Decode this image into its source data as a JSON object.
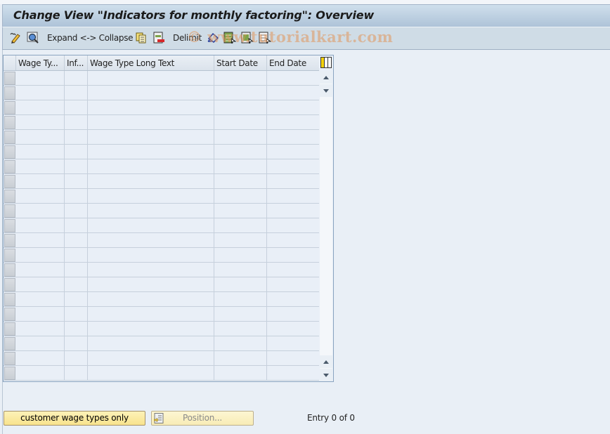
{
  "window": {
    "title": "Change View \"Indicators for monthly factoring\": Overview"
  },
  "toolbar": {
    "items": [
      {
        "type": "icon",
        "icon": "display-change-icon",
        "label": ""
      },
      {
        "type": "icon",
        "icon": "find-icon",
        "label": ""
      },
      {
        "type": "text",
        "label": "Expand <-> Collapse"
      },
      {
        "type": "icon",
        "icon": "copy-as-icon",
        "label": ""
      },
      {
        "type": "icon",
        "icon": "delete-icon",
        "label": ""
      },
      {
        "type": "text",
        "label": "Delimit"
      },
      {
        "type": "icon",
        "icon": "undo-change-icon",
        "label": ""
      },
      {
        "type": "icon",
        "icon": "select-all-icon",
        "label": ""
      },
      {
        "type": "icon",
        "icon": "select-block-icon",
        "label": ""
      },
      {
        "type": "icon",
        "icon": "deselect-all-icon",
        "label": ""
      }
    ],
    "expand_collapse_label": "Expand <-> Collapse",
    "delimit_label": "Delimit",
    "watermark": "© www.tutorialkart.com"
  },
  "table": {
    "columns": [
      {
        "key": "wage_type",
        "label": "Wage Ty..."
      },
      {
        "key": "inf",
        "label": "Inf..."
      },
      {
        "key": "long_text",
        "label": "Wage Type Long Text"
      },
      {
        "key": "start_date",
        "label": "Start Date"
      },
      {
        "key": "end_date",
        "label": "End Date"
      }
    ],
    "rows": [],
    "visible_empty_rows": 21
  },
  "footer": {
    "customer_button_label": "customer wage types only",
    "position_button_label": "Position...",
    "entry_status": "Entry 0 of 0"
  },
  "colors": {
    "title_bar": "#aec3d8",
    "toolbar": "#cfdce6",
    "background": "#e9eff6",
    "button": "#f8e38d"
  }
}
